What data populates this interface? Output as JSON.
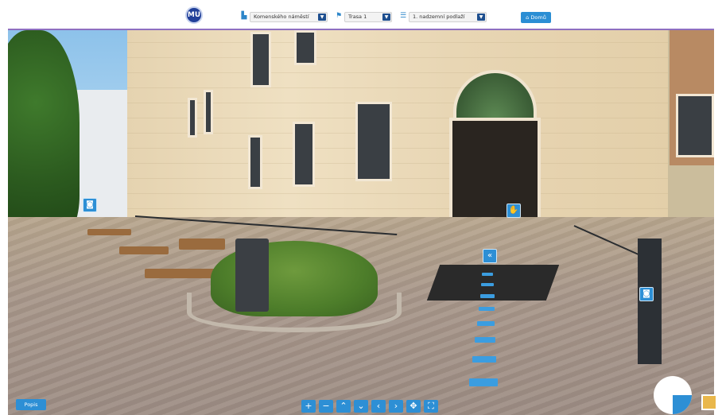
{
  "header": {
    "logo_text": "MU",
    "location_select": {
      "value": "Komenského náměstí",
      "icon": "building-icon"
    },
    "route_select": {
      "value": "Trasa 1",
      "icon": "route-icon"
    },
    "floor_select": {
      "value": "1. nadzemní podlaží",
      "icon": "layers-icon"
    },
    "home_button": {
      "label": "Domů",
      "icon": "home-icon"
    }
  },
  "hotspots": [
    {
      "name": "camera-hotspot-left",
      "icon": "camera-icon",
      "glyph": "◙"
    },
    {
      "name": "door-info-hotspot",
      "icon": "door-icon",
      "glyph": "✋"
    },
    {
      "name": "back-navigation-hotspot",
      "icon": "double-chevron-left-icon",
      "glyph": "«"
    },
    {
      "name": "camera-hotspot-right",
      "icon": "camera-icon",
      "glyph": "◙"
    }
  ],
  "footer": {
    "description_button": "Popis",
    "controls": [
      {
        "name": "zoom-in-button",
        "glyph": "+"
      },
      {
        "name": "zoom-out-button",
        "glyph": "−"
      },
      {
        "name": "look-up-button",
        "glyph": "⌃"
      },
      {
        "name": "look-down-button",
        "glyph": "⌄"
      },
      {
        "name": "look-left-button",
        "glyph": "‹"
      },
      {
        "name": "look-right-button",
        "glyph": "›"
      },
      {
        "name": "autorotate-button",
        "glyph": "✥"
      },
      {
        "name": "fullscreen-button",
        "glyph": "⛶"
      }
    ]
  },
  "colors": {
    "accent": "#2d8fd5",
    "header_line": "#8e6fc1",
    "select_arrow": "#1e4f8f"
  }
}
